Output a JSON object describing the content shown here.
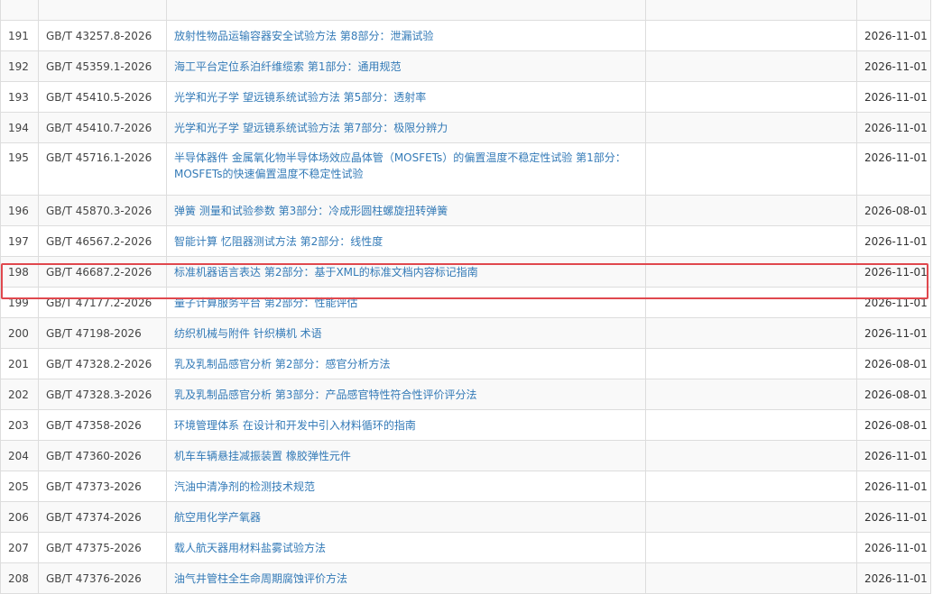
{
  "highlight_color": "#e0484e",
  "link_color": "#337ab7",
  "highlighted_row": "199",
  "rows": [
    {
      "no": "",
      "code": "",
      "title": "",
      "blank": "",
      "date": ""
    },
    {
      "no": "191",
      "code": "GB/T 43257.8-2026",
      "title": "放射性物品运输容器安全试验方法 第8部分：泄漏试验",
      "blank": "",
      "date": "2026-11-01"
    },
    {
      "no": "192",
      "code": "GB/T 45359.1-2026",
      "title": "海工平台定位系泊纤维缆索 第1部分：通用规范",
      "blank": "",
      "date": "2026-11-01"
    },
    {
      "no": "193",
      "code": "GB/T 45410.5-2026",
      "title": "光学和光子学 望远镜系统试验方法 第5部分：透射率",
      "blank": "",
      "date": "2026-11-01"
    },
    {
      "no": "194",
      "code": "GB/T 45410.7-2026",
      "title": "光学和光子学 望远镜系统试验方法 第7部分：极限分辨力",
      "blank": "",
      "date": "2026-11-01"
    },
    {
      "no": "195",
      "code": "GB/T 45716.1-2026",
      "title": "半导体器件 金属氧化物半导体场效应晶体管（MOSFETs）的偏置温度不稳定性试验 第1部分：MOSFETs的快速偏置温度不稳定性试验",
      "blank": "",
      "date": "2026-11-01"
    },
    {
      "no": "196",
      "code": "GB/T 45870.3-2026",
      "title": "弹簧 测量和试验参数 第3部分：冷成形圆柱螺旋扭转弹簧",
      "blank": "",
      "date": "2026-08-01"
    },
    {
      "no": "197",
      "code": "GB/T 46567.2-2026",
      "title": "智能计算 忆阻器测试方法 第2部分：线性度",
      "blank": "",
      "date": "2026-11-01"
    },
    {
      "no": "198",
      "code": "GB/T 46687.2-2026",
      "title": "标准机器语言表达 第2部分：基于XML的标准文档内容标记指南",
      "blank": "",
      "date": "2026-11-01"
    },
    {
      "no": "199",
      "code": "GB/T 47177.2-2026",
      "title": "量子计算服务平台 第2部分：性能评估",
      "blank": "",
      "date": "2026-11-01"
    },
    {
      "no": "200",
      "code": "GB/T 47198-2026",
      "title": "纺织机械与附件 针织横机 术语",
      "blank": "",
      "date": "2026-11-01"
    },
    {
      "no": "201",
      "code": "GB/T 47328.2-2026",
      "title": "乳及乳制品感官分析 第2部分：感官分析方法",
      "blank": "",
      "date": "2026-08-01"
    },
    {
      "no": "202",
      "code": "GB/T 47328.3-2026",
      "title": "乳及乳制品感官分析 第3部分：产品感官特性符合性评价评分法",
      "blank": "",
      "date": "2026-08-01"
    },
    {
      "no": "203",
      "code": "GB/T 47358-2026",
      "title": "环境管理体系 在设计和开发中引入材料循环的指南",
      "blank": "",
      "date": "2026-08-01"
    },
    {
      "no": "204",
      "code": "GB/T 47360-2026",
      "title": "机车车辆悬挂减振装置 橡胶弹性元件",
      "blank": "",
      "date": "2026-11-01"
    },
    {
      "no": "205",
      "code": "GB/T 47373-2026",
      "title": "汽油中清净剂的检测技术规范",
      "blank": "",
      "date": "2026-11-01"
    },
    {
      "no": "206",
      "code": "GB/T 47374-2026",
      "title": "航空用化学产氧器",
      "blank": "",
      "date": "2026-11-01"
    },
    {
      "no": "207",
      "code": "GB/T 47375-2026",
      "title": "载人航天器用材料盐雾试验方法",
      "blank": "",
      "date": "2026-11-01"
    },
    {
      "no": "208",
      "code": "GB/T 47376-2026",
      "title": "油气井管柱全生命周期腐蚀评价方法",
      "blank": "",
      "date": "2026-11-01"
    }
  ]
}
